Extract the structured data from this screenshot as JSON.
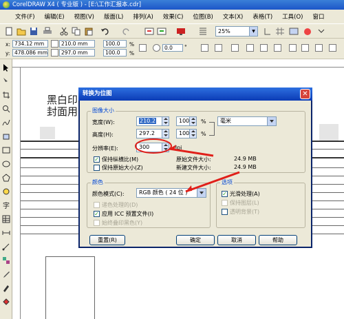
{
  "window": {
    "title": "CorelDRAW X4 ( 专业版 ) - [E:\\工作汇报本.cdr]"
  },
  "menu": [
    "文件(F)",
    "编辑(E)",
    "视图(V)",
    "版面(L)",
    "排列(A)",
    "效果(C)",
    "位图(B)",
    "文本(X)",
    "表格(T)",
    "工具(O)",
    "窗口"
  ],
  "toolbar": {
    "zoom": "25%"
  },
  "property_bar": {
    "x_label": "x:",
    "x_value": "734.12 mm",
    "y_label": "y:",
    "y_value": "478.086 mm",
    "w_value": "210.0 mm",
    "h_value": "297.0 mm",
    "sx_value": "100.0",
    "sy_value": "100.0",
    "pct": "%",
    "rotate_value": "0.0",
    "deg": "°"
  },
  "document": {
    "line1": "黑白印",
    "line2": "封面用"
  },
  "dialog": {
    "title": "转换为位图",
    "image_size": {
      "group_title": "图像大小",
      "width_label": "宽度(W):",
      "width_value": "210.2",
      "height_label": "高度(H):",
      "height_value": "297.2",
      "width_pct": "100",
      "height_pct": "100",
      "pct_sign": "%",
      "unit": "毫米",
      "resolution_label": "分辨率(E):",
      "resolution_value": "300",
      "resolution_unit": "dpi",
      "keep_ratio_label": "保持纵横比(M)",
      "keep_ratio_checked": true,
      "keep_size_label": "保持原始大小(Z)",
      "keep_size_checked": false,
      "orig_size_label": "原始文件大小:",
      "orig_size_value": "24.9 MB",
      "new_size_label": "新建文件大小:",
      "new_size_value": "24.9 MB"
    },
    "color": {
      "group_title": "颜色",
      "mode_label": "颜色模式(C):",
      "mode_value": "RGB 颜色 ( 24 位 )",
      "dither_label": "递色处理的(D)",
      "icc_label": "应用 ICC 预置文件(I)",
      "icc_checked": true,
      "overprint_label": "始终叠印黑色(Y)"
    },
    "options": {
      "group_title": "选项",
      "smooth_label": "光滑处理(A)",
      "smooth_checked": true,
      "keep_layers_label": "保持图层(L)",
      "transparent_label": "透明背景(T)"
    },
    "buttons": {
      "reset": "重置(R)",
      "ok": "确定",
      "cancel": "取消",
      "help": "帮助"
    }
  },
  "colors": {
    "title_blue": "#0b3bb5",
    "annotation_red": "#e0201a",
    "group_title": "#0046d5"
  }
}
